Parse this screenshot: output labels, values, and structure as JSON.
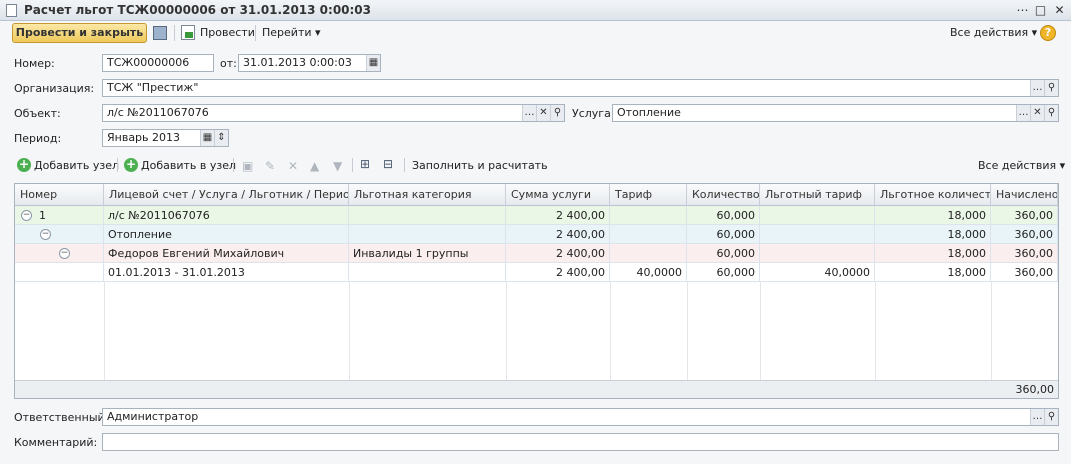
{
  "window": {
    "title": "Расчет льгот ТСЖ00000006 от 31.01.2013 0:00:03"
  },
  "toolbar": {
    "post_close": "Провести и закрыть",
    "post": "Провести",
    "goto": "Перейти",
    "all_actions": "Все действия",
    "help": "?"
  },
  "form": {
    "number_label": "Номер:",
    "number_value": "ТСЖ00000006",
    "date_label": "от:",
    "date_value": "31.01.2013  0:00:03",
    "org_label": "Организация:",
    "org_value": "ТСЖ \"Престиж\"",
    "object_label": "Объект:",
    "object_value": "л/с №2011067076",
    "service_label": "Услуга:",
    "service_value": "Отопление",
    "period_label": "Период:",
    "period_value": "Январь 2013",
    "responsible_label": "Ответственный:",
    "responsible_value": "Администратор",
    "comment_label": "Комментарий:",
    "comment_value": ""
  },
  "table_toolbar": {
    "add_node": "Добавить узел",
    "add_into_node": "Добавить в узел",
    "fill_calc": "Заполнить и расчитать",
    "all_actions": "Все действия"
  },
  "table": {
    "headers": [
      "Номер",
      "Лицевой счет / Услуга / Льготник / Период",
      "Льготная категория",
      "Сумма услуги",
      "Тариф",
      "Количество",
      "Льготный тариф",
      "Льготное количест...",
      "Начислено"
    ],
    "rows": [
      {
        "num": "1",
        "name": "л/с №2011067076",
        "category": "",
        "sum": "2 400,00",
        "tariff": "",
        "qty": "60,000",
        "benefit_tariff": "",
        "benefit_qty": "18,000",
        "charged": "360,00"
      },
      {
        "num": "",
        "name": "Отопление",
        "category": "",
        "sum": "2 400,00",
        "tariff": "",
        "qty": "60,000",
        "benefit_tariff": "",
        "benefit_qty": "18,000",
        "charged": "360,00"
      },
      {
        "num": "",
        "name": "Федоров Евгений Михайлович",
        "category": "Инвалиды 1 группы",
        "sum": "2 400,00",
        "tariff": "",
        "qty": "60,000",
        "benefit_tariff": "",
        "benefit_qty": "18,000",
        "charged": "360,00"
      },
      {
        "num": "",
        "name": "01.01.2013 - 31.01.2013",
        "category": "",
        "sum": "2 400,00",
        "tariff": "40,0000",
        "qty": "60,000",
        "benefit_tariff": "40,0000",
        "benefit_qty": "18,000",
        "charged": "360,00"
      }
    ],
    "total_charged": "360,00"
  }
}
